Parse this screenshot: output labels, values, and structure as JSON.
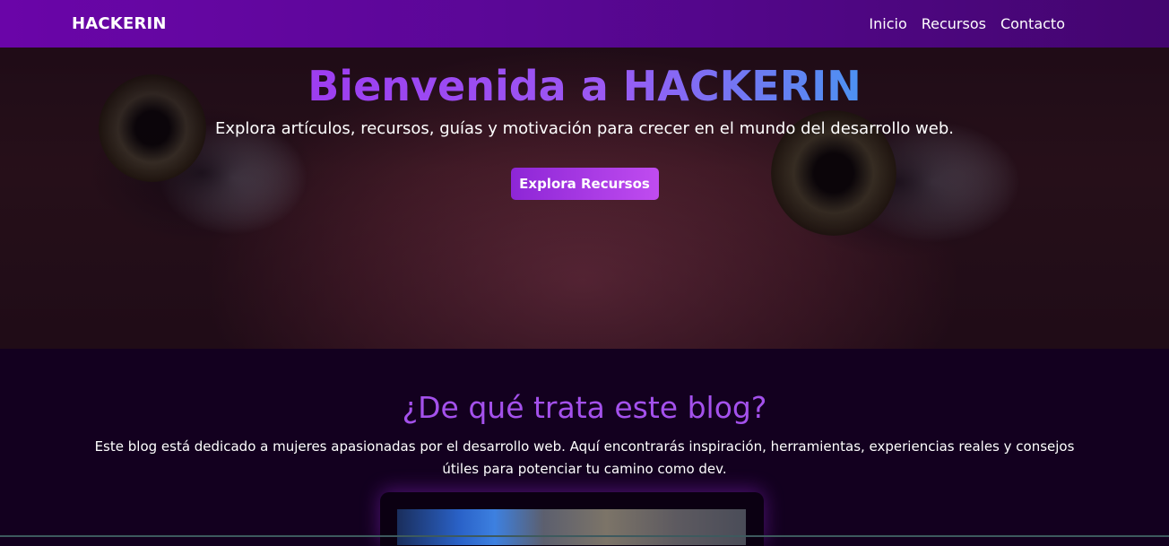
{
  "nav": {
    "brand": "HACKERIN",
    "links": [
      "Inicio",
      "Recursos",
      "Contacto"
    ]
  },
  "hero": {
    "title": "Bienvenida a HACKERIN",
    "subtitle": "Explora artículos, recursos, guías y motivación para crecer en el mundo del desarrollo web.",
    "cta_label": "Explora Recursos"
  },
  "about": {
    "title": "¿De qué trata este blog?",
    "text": "Este blog está dedicado a mujeres apasionadas por el desarrollo web. Aquí encontrarás inspiración, herramientas, experiencias reales y consejos útiles para potenciar tu camino como dev."
  },
  "colors": {
    "nav_start": "#6a05a8",
    "nav_end": "#43056f",
    "accent": "#a451ec",
    "cta_start": "#8d26d6",
    "cta_end": "#c04cf0",
    "title_gradient_end": "#4c92f2",
    "section_bg": "#13001f"
  }
}
